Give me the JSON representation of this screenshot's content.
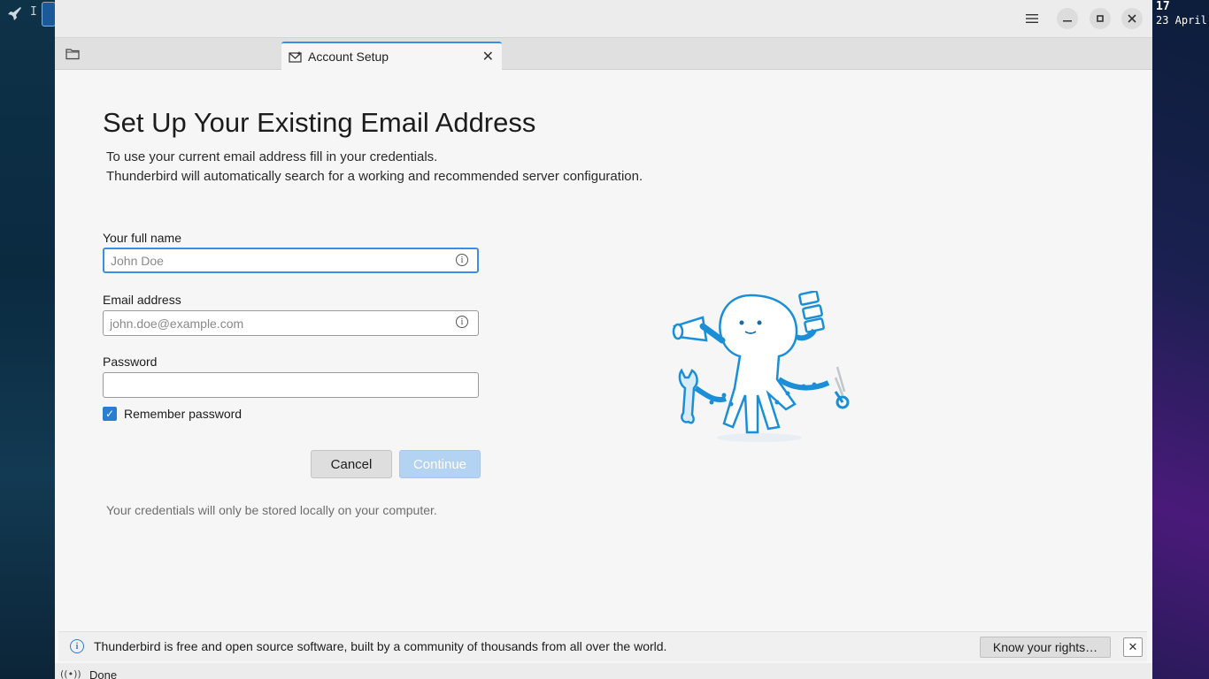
{
  "desktop": {
    "launcher_text": "I",
    "clock_hour": "17",
    "clock_date": "23 April"
  },
  "window": {
    "menu_icon": "hamburger-menu-icon",
    "minimize_icon": "minimize-icon",
    "maximize_icon": "maximize-icon",
    "close_icon": "close-icon"
  },
  "tabs": [
    {
      "icon": "folder-icon",
      "label": ""
    },
    {
      "icon": "envelope-icon",
      "label": "Account Setup",
      "active": true
    }
  ],
  "form": {
    "heading": "Set Up Your Existing Email Address",
    "subtitle_line1": "To use your current email address fill in your credentials.",
    "subtitle_line2": "Thunderbird will automatically search for a working and recommended server configuration.",
    "name_label": "Your full name",
    "name_placeholder": "John Doe",
    "name_value": "",
    "email_label": "Email address",
    "email_placeholder": "john.doe@example.com",
    "email_value": "",
    "password_label": "Password",
    "password_value": "",
    "remember_label": "Remember password",
    "remember_checked": true,
    "cancel_label": "Cancel",
    "continue_label": "Continue",
    "note": "Your credentials will only be stored locally on your computer."
  },
  "infobar": {
    "text": "Thunderbird is free and open source software, built by a community of thousands from all over the world.",
    "button_label": "Know your rights…"
  },
  "status": {
    "text": "Done"
  },
  "colors": {
    "accent": "#3a8ee6",
    "checkbox": "#2a7ed2",
    "continue_disabled": "#b4d2f2"
  }
}
